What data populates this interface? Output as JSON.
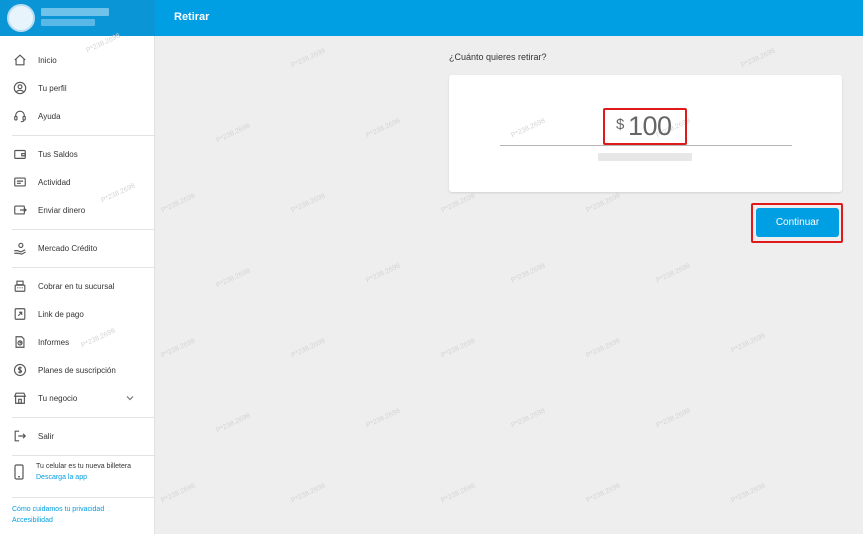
{
  "header": {
    "title": "Retirar"
  },
  "sidebar": {
    "items": [
      {
        "label": "Inicio",
        "icon": "home-icon"
      },
      {
        "label": "Tu perfil",
        "icon": "profile-icon"
      },
      {
        "label": "Ayuda",
        "icon": "headset-icon"
      },
      {
        "label": "Tus Saldos",
        "icon": "wallet-icon"
      },
      {
        "label": "Actividad",
        "icon": "activity-icon"
      },
      {
        "label": "Enviar dinero",
        "icon": "send-money-icon"
      },
      {
        "label": "Mercado Crédito",
        "icon": "credit-hand-icon"
      },
      {
        "label": "Cobrar en tu sucursal",
        "icon": "cash-register-icon"
      },
      {
        "label": "Link de pago",
        "icon": "link-icon"
      },
      {
        "label": "Informes",
        "icon": "report-icon"
      },
      {
        "label": "Planes de suscripción",
        "icon": "subscription-icon"
      },
      {
        "label": "Tu negocio",
        "icon": "store-icon"
      },
      {
        "label": "Salir",
        "icon": "logout-icon"
      }
    ],
    "promo": {
      "text": "Tu celular es tu nueva billetera",
      "link": "Descarga la app"
    },
    "footer": {
      "privacy": "Cómo cuidamos tu privacidad",
      "accessibility": "Accesibilidad"
    }
  },
  "main": {
    "question": "¿Cuánto quieres retirar?",
    "currency": "$",
    "amount": "100",
    "continue_label": "Continuar"
  },
  "watermark": "P*238.2698",
  "colors": {
    "brand": "#009ee3",
    "highlight": "#e0191b"
  }
}
